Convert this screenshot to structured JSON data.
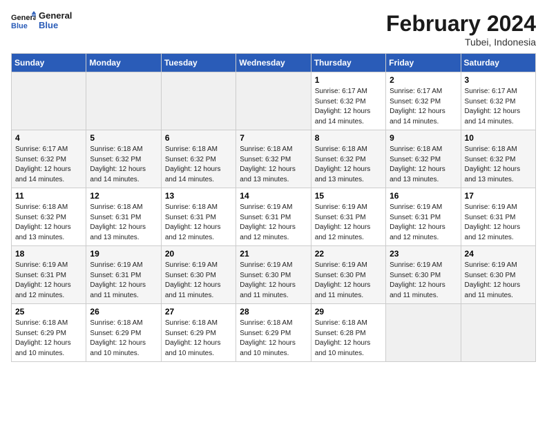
{
  "header": {
    "logo_general": "General",
    "logo_blue": "Blue",
    "month_title": "February 2024",
    "subtitle": "Tubei, Indonesia"
  },
  "weekdays": [
    "Sunday",
    "Monday",
    "Tuesday",
    "Wednesday",
    "Thursday",
    "Friday",
    "Saturday"
  ],
  "weeks": [
    {
      "days": [
        {
          "num": "",
          "info": "",
          "empty": true
        },
        {
          "num": "",
          "info": "",
          "empty": true
        },
        {
          "num": "",
          "info": "",
          "empty": true
        },
        {
          "num": "",
          "info": "",
          "empty": true
        },
        {
          "num": "1",
          "info": "Sunrise: 6:17 AM\nSunset: 6:32 PM\nDaylight: 12 hours\nand 14 minutes.",
          "empty": false
        },
        {
          "num": "2",
          "info": "Sunrise: 6:17 AM\nSunset: 6:32 PM\nDaylight: 12 hours\nand 14 minutes.",
          "empty": false
        },
        {
          "num": "3",
          "info": "Sunrise: 6:17 AM\nSunset: 6:32 PM\nDaylight: 12 hours\nand 14 minutes.",
          "empty": false
        }
      ]
    },
    {
      "days": [
        {
          "num": "4",
          "info": "Sunrise: 6:17 AM\nSunset: 6:32 PM\nDaylight: 12 hours\nand 14 minutes.",
          "empty": false
        },
        {
          "num": "5",
          "info": "Sunrise: 6:18 AM\nSunset: 6:32 PM\nDaylight: 12 hours\nand 14 minutes.",
          "empty": false
        },
        {
          "num": "6",
          "info": "Sunrise: 6:18 AM\nSunset: 6:32 PM\nDaylight: 12 hours\nand 14 minutes.",
          "empty": false
        },
        {
          "num": "7",
          "info": "Sunrise: 6:18 AM\nSunset: 6:32 PM\nDaylight: 12 hours\nand 13 minutes.",
          "empty": false
        },
        {
          "num": "8",
          "info": "Sunrise: 6:18 AM\nSunset: 6:32 PM\nDaylight: 12 hours\nand 13 minutes.",
          "empty": false
        },
        {
          "num": "9",
          "info": "Sunrise: 6:18 AM\nSunset: 6:32 PM\nDaylight: 12 hours\nand 13 minutes.",
          "empty": false
        },
        {
          "num": "10",
          "info": "Sunrise: 6:18 AM\nSunset: 6:32 PM\nDaylight: 12 hours\nand 13 minutes.",
          "empty": false
        }
      ]
    },
    {
      "days": [
        {
          "num": "11",
          "info": "Sunrise: 6:18 AM\nSunset: 6:32 PM\nDaylight: 12 hours\nand 13 minutes.",
          "empty": false
        },
        {
          "num": "12",
          "info": "Sunrise: 6:18 AM\nSunset: 6:31 PM\nDaylight: 12 hours\nand 13 minutes.",
          "empty": false
        },
        {
          "num": "13",
          "info": "Sunrise: 6:18 AM\nSunset: 6:31 PM\nDaylight: 12 hours\nand 12 minutes.",
          "empty": false
        },
        {
          "num": "14",
          "info": "Sunrise: 6:19 AM\nSunset: 6:31 PM\nDaylight: 12 hours\nand 12 minutes.",
          "empty": false
        },
        {
          "num": "15",
          "info": "Sunrise: 6:19 AM\nSunset: 6:31 PM\nDaylight: 12 hours\nand 12 minutes.",
          "empty": false
        },
        {
          "num": "16",
          "info": "Sunrise: 6:19 AM\nSunset: 6:31 PM\nDaylight: 12 hours\nand 12 minutes.",
          "empty": false
        },
        {
          "num": "17",
          "info": "Sunrise: 6:19 AM\nSunset: 6:31 PM\nDaylight: 12 hours\nand 12 minutes.",
          "empty": false
        }
      ]
    },
    {
      "days": [
        {
          "num": "18",
          "info": "Sunrise: 6:19 AM\nSunset: 6:31 PM\nDaylight: 12 hours\nand 12 minutes.",
          "empty": false
        },
        {
          "num": "19",
          "info": "Sunrise: 6:19 AM\nSunset: 6:31 PM\nDaylight: 12 hours\nand 11 minutes.",
          "empty": false
        },
        {
          "num": "20",
          "info": "Sunrise: 6:19 AM\nSunset: 6:30 PM\nDaylight: 12 hours\nand 11 minutes.",
          "empty": false
        },
        {
          "num": "21",
          "info": "Sunrise: 6:19 AM\nSunset: 6:30 PM\nDaylight: 12 hours\nand 11 minutes.",
          "empty": false
        },
        {
          "num": "22",
          "info": "Sunrise: 6:19 AM\nSunset: 6:30 PM\nDaylight: 12 hours\nand 11 minutes.",
          "empty": false
        },
        {
          "num": "23",
          "info": "Sunrise: 6:19 AM\nSunset: 6:30 PM\nDaylight: 12 hours\nand 11 minutes.",
          "empty": false
        },
        {
          "num": "24",
          "info": "Sunrise: 6:19 AM\nSunset: 6:30 PM\nDaylight: 12 hours\nand 11 minutes.",
          "empty": false
        }
      ]
    },
    {
      "days": [
        {
          "num": "25",
          "info": "Sunrise: 6:18 AM\nSunset: 6:29 PM\nDaylight: 12 hours\nand 10 minutes.",
          "empty": false
        },
        {
          "num": "26",
          "info": "Sunrise: 6:18 AM\nSunset: 6:29 PM\nDaylight: 12 hours\nand 10 minutes.",
          "empty": false
        },
        {
          "num": "27",
          "info": "Sunrise: 6:18 AM\nSunset: 6:29 PM\nDaylight: 12 hours\nand 10 minutes.",
          "empty": false
        },
        {
          "num": "28",
          "info": "Sunrise: 6:18 AM\nSunset: 6:29 PM\nDaylight: 12 hours\nand 10 minutes.",
          "empty": false
        },
        {
          "num": "29",
          "info": "Sunrise: 6:18 AM\nSunset: 6:28 PM\nDaylight: 12 hours\nand 10 minutes.",
          "empty": false
        },
        {
          "num": "",
          "info": "",
          "empty": true
        },
        {
          "num": "",
          "info": "",
          "empty": true
        }
      ]
    }
  ]
}
